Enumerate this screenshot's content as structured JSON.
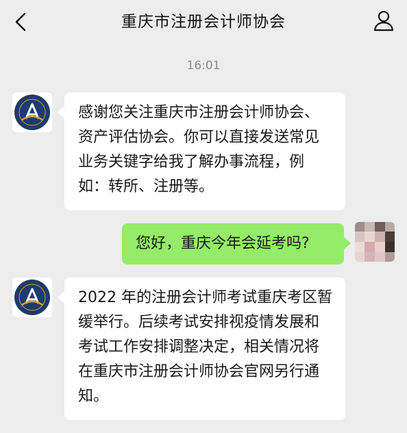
{
  "header": {
    "title": "重庆市注册会计师协会",
    "back_icon": "chevron-left-icon",
    "profile_icon": "person-icon"
  },
  "chat": {
    "timestamp": "16:01",
    "messages": [
      {
        "sender": "association",
        "text": "感谢您关注重庆市注册会计师协会、资产评估协会。你可以直接发送常见业务关键字给我了解办事流程，例如：转所、注册等。"
      },
      {
        "sender": "user",
        "text": "您好，重庆今年会延考吗?"
      },
      {
        "sender": "association",
        "text": "2022 年的注册会计师考试重庆考区暂缓举行。后续考试安排视疫情发展和考试工作安排调整决定，相关情况将在重庆市注册会计师协会官网另行通知。"
      }
    ]
  },
  "colors": {
    "background": "#ededed",
    "incoming_bubble": "#ffffff",
    "outgoing_bubble": "#95ec69",
    "logo_navy": "#1f3a6d",
    "logo_gold": "#d8a52a"
  }
}
